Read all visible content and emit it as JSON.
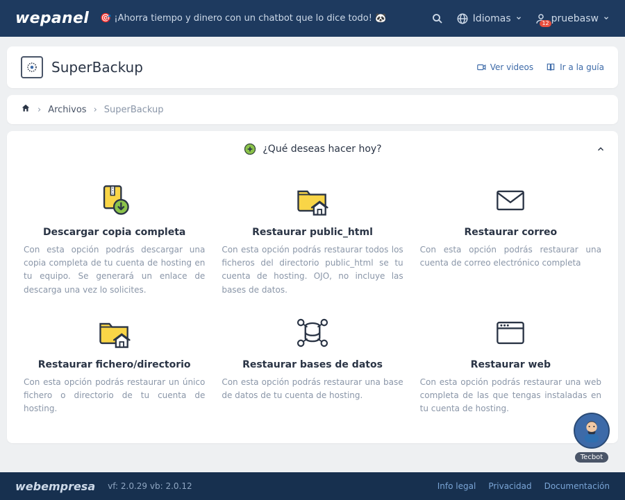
{
  "nav": {
    "logo": "wepanel",
    "promo": "🎯 ¡Ahorra tiempo y dinero con un chatbot que lo dice todo! 🐼",
    "languages": "Idiomas",
    "user": "pruebasw",
    "notif_count": "12"
  },
  "title": {
    "text": "SuperBackup",
    "videos": "Ver videos",
    "guide": "Ir a la guía"
  },
  "crumb": {
    "archivos": "Archivos",
    "current": "SuperBackup"
  },
  "panel": {
    "heading": "¿Qué deseas hacer hoy?"
  },
  "tiles": [
    {
      "title": "Descargar copia completa",
      "desc": "Con esta opción podrás descargar una copia completa de tu cuenta de hosting en tu equipo. Se generará un enlace de descarga una vez lo solicites."
    },
    {
      "title": "Restaurar public_html",
      "desc": "Con esta opción podrás restaurar todos los ficheros del directorio public_html se tu cuenta de hosting. OJO, no incluye las bases de datos."
    },
    {
      "title": "Restaurar correo",
      "desc": "Con esta opción podrás restaurar una cuenta de correo electrónico completa"
    },
    {
      "title": "Restaurar fichero/directorio",
      "desc": "Con esta opción podrás restaurar un único fichero o directorio de tu cuenta de hosting."
    },
    {
      "title": "Restaurar bases de datos",
      "desc": "Con esta opción podrás restaurar una base de datos de tu cuenta de hosting."
    },
    {
      "title": "Restaurar web",
      "desc": "Con esta opción podrás restaurar una web completa de las que tengas instaladas en tu cuenta de hosting."
    }
  ],
  "chat": {
    "label": "Tecbot"
  },
  "footer": {
    "logo": "webempresa",
    "version": "vf: 2.0.29 vb: 2.0.12",
    "legal": "Info legal",
    "privacy": "Privacidad",
    "docs": "Documentación"
  }
}
